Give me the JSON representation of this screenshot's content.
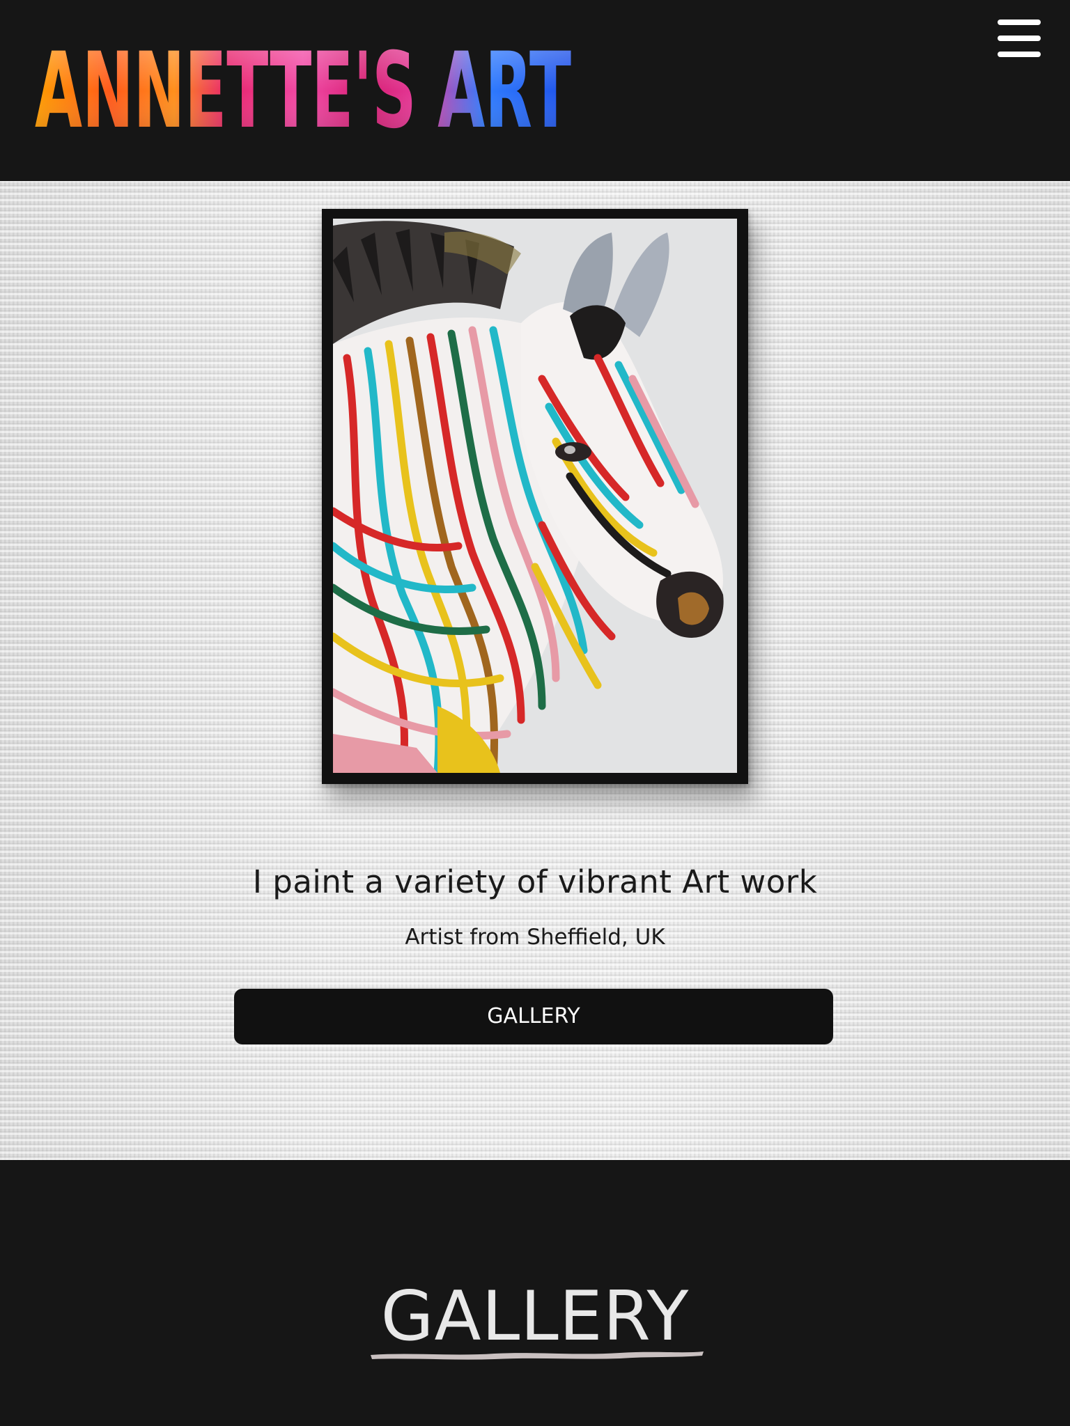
{
  "header": {
    "logo_text": "ANNETTE'S ART",
    "menu_icon": "hamburger-menu-icon"
  },
  "hero": {
    "artwork": "zebra-painting",
    "tagline": "I paint a variety of vibrant Art work",
    "subtitle": "Artist from Sheffield, UK",
    "cta_label": "GALLERY"
  },
  "gallery_section": {
    "heading": "GALLERY"
  },
  "colors": {
    "header_bg": "#161616",
    "button_bg": "#111111",
    "button_text": "#ffffff",
    "heading_text": "#e8e8e8",
    "logo_orange": "#ff8a00",
    "logo_pink": "#ee3c9a",
    "logo_blue": "#1f5bff"
  }
}
